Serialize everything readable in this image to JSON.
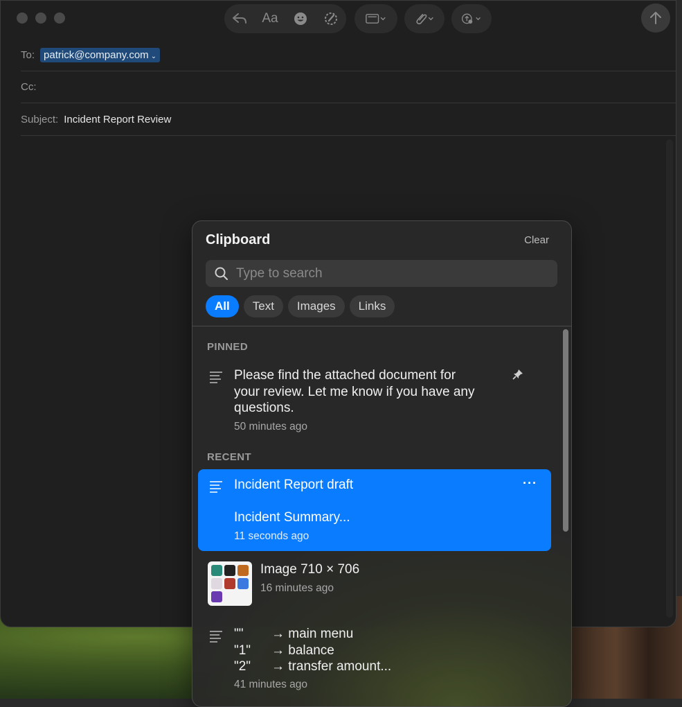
{
  "compose": {
    "to_label": "To:",
    "to_value": "patrick@company.com",
    "cc_label": "Cc:",
    "subject_label": "Subject:",
    "subject_value": "Incident Report Review"
  },
  "toolbar_icons": [
    "reply-icon",
    "format-text-icon",
    "emoji-icon",
    "markup-icon",
    "header-fields-icon",
    "attachment-icon",
    "photo-browser-icon",
    "send-icon"
  ],
  "toolbar": {
    "format_label": "Aa"
  },
  "clipboard": {
    "title": "Clipboard",
    "clear_label": "Clear",
    "search_placeholder": "Type to search",
    "filters": [
      "All",
      "Text",
      "Images",
      "Links"
    ],
    "active_filter": "All",
    "pinned_header": "PINNED",
    "recent_header": "RECENT",
    "pinned_item": {
      "line1": "Please find the attached document for",
      "line2": "your review. Let me know if you have any",
      "line3": "questions.",
      "time": "50 minutes ago"
    },
    "recent_items": [
      {
        "title": "Incident Report draft",
        "preview": "Incident Summary...",
        "time": "11 seconds ago",
        "selected": true
      },
      {
        "title": "Image 710 × 706",
        "time": "16 minutes ago",
        "type": "image"
      },
      {
        "rows": [
          {
            "key": "\"\"",
            "value": "→ main menu"
          },
          {
            "key": "\"1\"",
            "value": "→ balance"
          },
          {
            "key": "\"2\"",
            "value": "→ transfer amount..."
          }
        ],
        "time": "41 minutes ago"
      }
    ]
  },
  "colors": {
    "accent": "#0a7cff",
    "window_bg": "#1f1f1f",
    "panel_bg": "#282828"
  }
}
